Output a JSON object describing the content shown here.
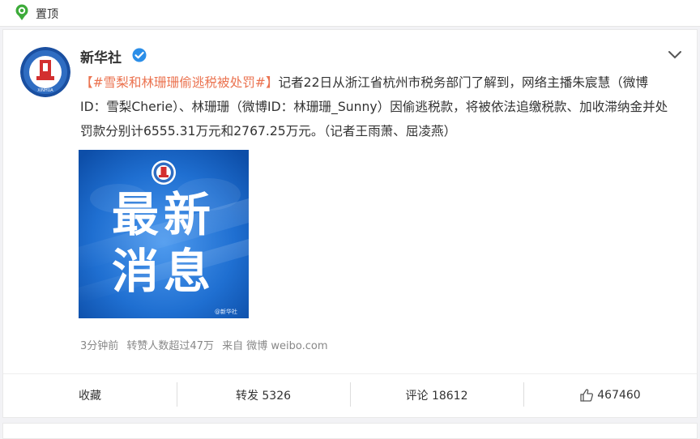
{
  "pinned": {
    "label": "置顶"
  },
  "post": {
    "author": "新华社",
    "text": {
      "open_bracket": "【",
      "topic": "#雪梨和林珊珊偷逃税被处罚#",
      "close_bracket": "】",
      "body": "记者22日从浙江省杭州市税务部门了解到，网络主播朱宸慧（微博ID：雪梨Cherie）、林珊珊（微博ID：林珊珊_Sunny）因偷逃税款，将被依法追缴税款、加收滞纳金并处罚款分别计6555.31万元和2767.25万元。（记者王雨萧、屈凌燕）"
    },
    "image": {
      "headline_line1": "最新",
      "headline_line2": "消息",
      "watermark": "@新华社"
    },
    "meta": {
      "time": "3分钟前",
      "reposts_note": "转赞人数超过47万",
      "source": "来自 微博 weibo.com"
    },
    "actions": {
      "favorite": "收藏",
      "repost": "转发 5326",
      "comment": "评论 18612",
      "like": "467460"
    }
  },
  "colors": {
    "topic": "#eb7350",
    "image_blue": "#1565c8",
    "verified": "#2b8ee8",
    "pin": "#3dab3a"
  }
}
